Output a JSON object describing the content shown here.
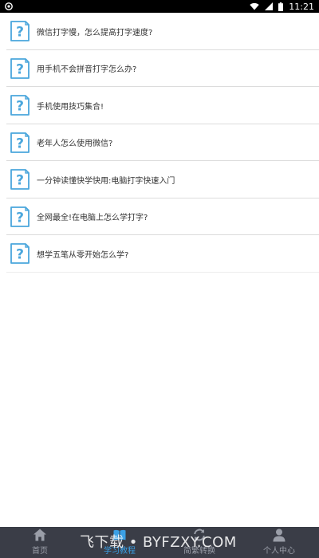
{
  "status_bar": {
    "time": "11:21",
    "icons": [
      "shield-icon",
      "wifi-icon",
      "signal-icon",
      "battery-icon"
    ]
  },
  "list": {
    "items": [
      {
        "title": "微信打字慢，怎么提高打字速度?",
        "icon": "question-doc-icon"
      },
      {
        "title": "用手机不会拼音打字怎么办?",
        "icon": "question-doc-icon"
      },
      {
        "title": "手机使用技巧集合!",
        "icon": "question-doc-icon"
      },
      {
        "title": "老年人怎么使用微信?",
        "icon": "question-doc-icon"
      },
      {
        "title": "一分钟读懂快学快用:电脑打字快速入门",
        "icon": "question-doc-icon"
      },
      {
        "title": "全网最全!在电脑上怎么学打字?",
        "icon": "question-doc-icon"
      },
      {
        "title": "想学五笔从零开始怎么学?",
        "icon": "question-doc-icon"
      }
    ]
  },
  "bottom_nav": {
    "items": [
      {
        "label": "首页",
        "icon": "home-icon",
        "active": false
      },
      {
        "label": "学习教程",
        "icon": "book-icon",
        "active": true
      },
      {
        "label": "简繁转换",
        "icon": "convert-icon",
        "active": false
      },
      {
        "label": "个人中心",
        "icon": "person-icon",
        "active": false
      }
    ],
    "active_color": "#3aa0e6",
    "background": "#3a3d47"
  },
  "watermark": {
    "text": "飞下载 • BYFZXY.COM"
  }
}
